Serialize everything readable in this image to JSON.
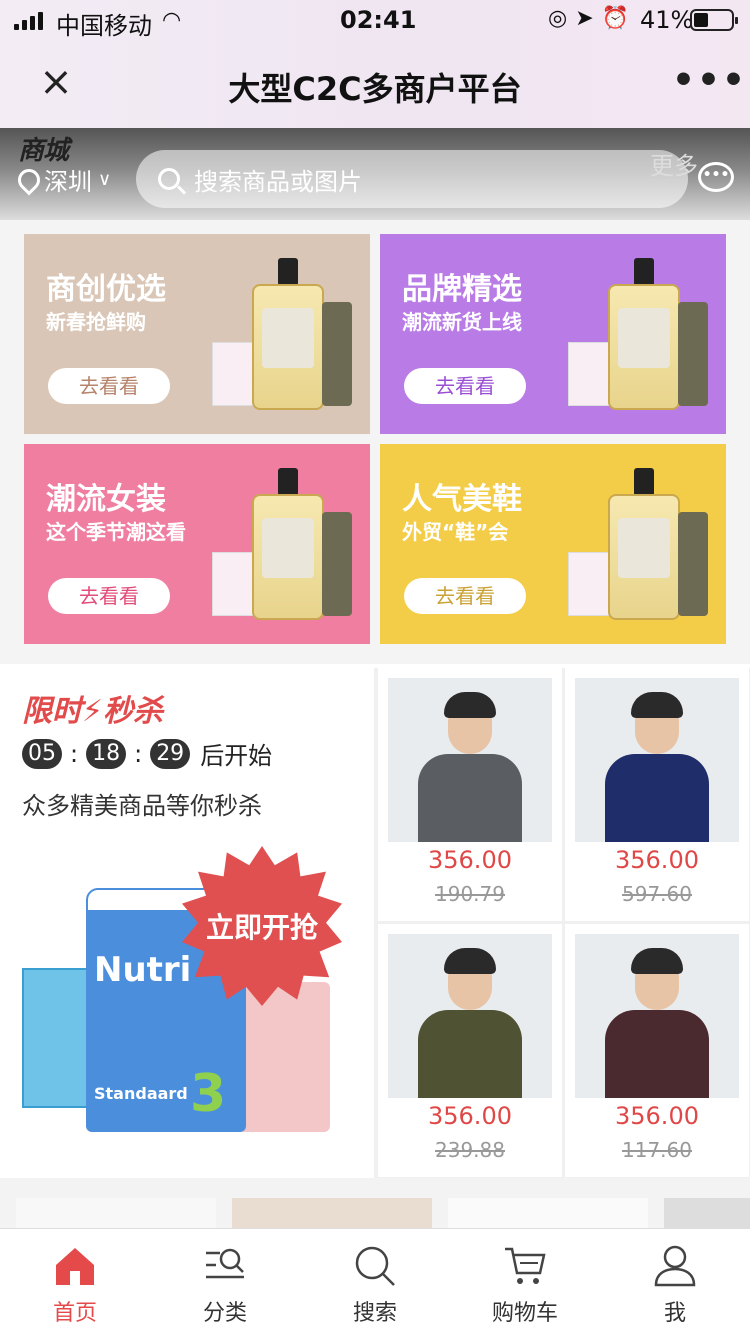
{
  "status_bar": {
    "carrier": "中国移动",
    "time": "02:41",
    "battery_pct": "41%"
  },
  "navbar": {
    "close_glyph": "×",
    "title": "大型C2C多商户平台",
    "more_glyph": "•••"
  },
  "header": {
    "logo_text": "商城",
    "city": "深圳",
    "search_placeholder": "搜索商品或图片",
    "more_text": "更多",
    "chat_glyph": "•••"
  },
  "banners": [
    {
      "title": "商创优选",
      "subtitle": "新春抢鲜购",
      "button": "去看看",
      "bg": "#d9c6b6",
      "btn_color": "#b6836b"
    },
    {
      "title": "品牌精选",
      "subtitle": "潮流新货上线",
      "button": "去看看",
      "bg": "#b97be6",
      "btn_color": "#9a4fd4"
    },
    {
      "title": "潮流女装",
      "subtitle": "这个季节潮这看",
      "button": "去看看",
      "bg": "#ef7ea1",
      "btn_color": "#e24d7a"
    },
    {
      "title": "人气美鞋",
      "subtitle": "外贸“鞋”会",
      "button": "去看看",
      "bg": "#f3cd47",
      "btn_color": "#caa236"
    }
  ],
  "flash_sale": {
    "title": "限时",
    "title_bolt": "⚡",
    "title2": "秒杀",
    "countdown": {
      "h": "05",
      "m": "18",
      "s": "29",
      "sep": ":",
      "suffix": "后开始"
    },
    "subtitle": "众多精美商品等你秒杀",
    "promo_badge": "立即开抢",
    "promo_brand": "Nutri",
    "promo_number": "3",
    "promo_label": "Standaard",
    "products": [
      {
        "price": "356.00",
        "old_price": "190.79",
        "outfit": "#5a5d62"
      },
      {
        "price": "356.00",
        "old_price": "597.60",
        "outfit": "#1f2e6b"
      },
      {
        "price": "356.00",
        "old_price": "239.88",
        "outfit": "#4f5233"
      },
      {
        "price": "356.00",
        "old_price": "117.60",
        "outfit": "#4a2a2e"
      }
    ]
  },
  "tabbar": [
    {
      "label": "首页",
      "icon": "home-icon",
      "active": true
    },
    {
      "label": "分类",
      "icon": "category-icon",
      "active": false
    },
    {
      "label": "搜索",
      "icon": "search-icon",
      "active": false
    },
    {
      "label": "购物车",
      "icon": "cart-icon",
      "active": false
    },
    {
      "label": "我",
      "icon": "user-icon",
      "active": false
    }
  ],
  "colors": {
    "accent": "#e44a4a",
    "price": "#e04848"
  }
}
